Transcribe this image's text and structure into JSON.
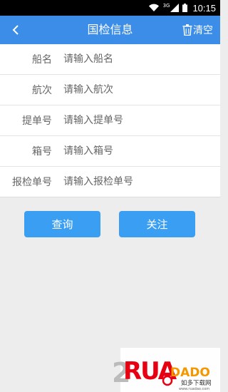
{
  "status_bar": {
    "network": "3G",
    "time": "10:15"
  },
  "header": {
    "title": "国检信息",
    "clear_label": "清空"
  },
  "form": {
    "fields": [
      {
        "label": "船名",
        "placeholder": "请输入船名",
        "value": ""
      },
      {
        "label": "航次",
        "placeholder": "请输入航次",
        "value": ""
      },
      {
        "label": "提单号",
        "placeholder": "请输入提单号",
        "value": ""
      },
      {
        "label": "箱号",
        "placeholder": "请输入箱号",
        "value": ""
      },
      {
        "label": "报检单号",
        "placeholder": "请输入报检单号",
        "value": ""
      }
    ]
  },
  "actions": {
    "query_label": "查询",
    "follow_label": "关注"
  },
  "watermark": {
    "brand": "RUANDADO",
    "cn_text": "如多下载网",
    "url": "www.ruadao.com"
  },
  "colors": {
    "header_bg": "#3c8de8",
    "button_bg": "#3a9ff2",
    "page_bg": "#ededed"
  }
}
